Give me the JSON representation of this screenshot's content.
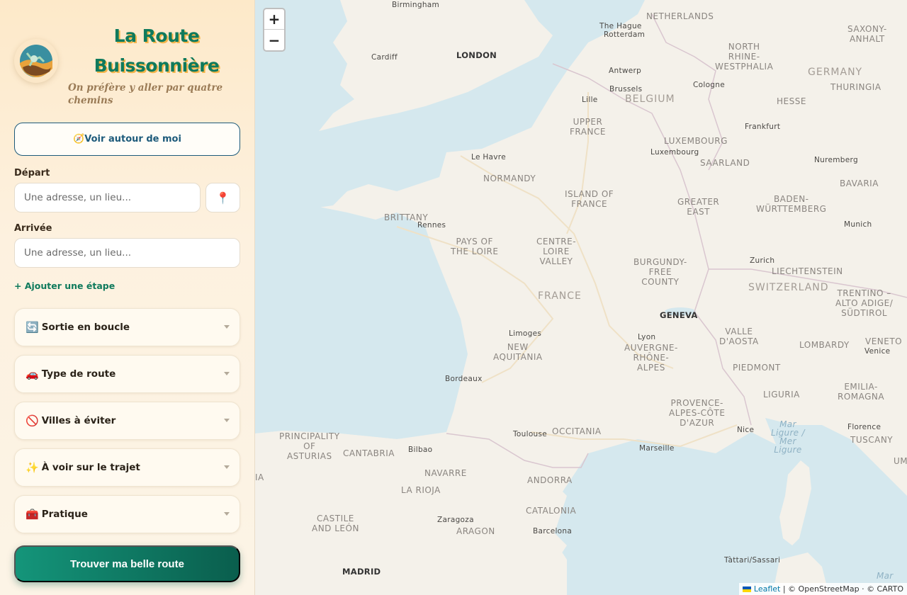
{
  "brand": {
    "title_line1": "La Route",
    "title_line2": "Buissonnière",
    "subtitle": "On préfère y aller par quatre chemins"
  },
  "locate_button": {
    "icon": "compass-icon",
    "label": "🧭Voir autour de moi"
  },
  "departure": {
    "label": "Départ",
    "placeholder": "Une adresse, un lieu...",
    "pin_icon": "📍"
  },
  "arrival": {
    "label": "Arrivée",
    "placeholder": "Une adresse, un lieu..."
  },
  "add_step": "+ Ajouter une étape",
  "sections": [
    {
      "emoji": "🔄",
      "label": "Sortie en boucle"
    },
    {
      "emoji": "🚗",
      "label": "Type de route"
    },
    {
      "emoji": "🚫",
      "label": "Villes à éviter"
    },
    {
      "emoji": "✨",
      "label": "À voir sur le trajet"
    },
    {
      "emoji": "🧰",
      "label": "Pratique"
    }
  ],
  "cta": "Trouver ma belle route",
  "map": {
    "zoom_in": "+",
    "zoom_out": "−",
    "labels": {
      "birmingham": "Birmingham",
      "london": "LONDON",
      "cardiff": "Cardiff",
      "the_hague": "The Hague",
      "rotterdam": "Rotterdam",
      "netherlands": "NETHERLANDS",
      "saxony": "SAXONY-\nANHALT",
      "nrw": "NORTH\nRHINE-\nWESTPHALIA",
      "germany": "GERMANY",
      "antwerp": "Antwerp",
      "brussels": "Brussels",
      "cologne": "Cologne",
      "thuringia": "THURINGIA",
      "lille": "Lille",
      "belgium": "BELGIUM",
      "hesse": "HESSE",
      "upper_france": "UPPER\nFRANCE",
      "frankfurt": "Frankfurt",
      "luxembourg_r": "LUXEMBOURG",
      "luxembourg": "Luxembourg",
      "le_havre": "Le Havre",
      "saarland": "SAARLAND",
      "nuremberg": "Nuremberg",
      "normandy": "NORMANDY",
      "island_of_france": "ISLAND OF\nFRANCE",
      "greater_east": "GREATER\nEAST",
      "baden": "BADEN-\nWÜRTTEMBERG",
      "bavaria": "BAVARIA",
      "brittany": "BRITTANY",
      "rennes": "Rennes",
      "munich": "Munich",
      "pays_loire": "PAYS OF\nTHE LOIRE",
      "centre": "CENTRE-\nLOIRE\nVALLEY",
      "burgundy": "BURGUNDY-\nFREE\nCOUNTY",
      "zurich": "Zurich",
      "liechtenstein": "LIECHTENSTEIN",
      "switzerland": "SWITZERLAND",
      "trentino": "TRENTINO –\nALTO ADIGE/\nSÜDTIROL",
      "france": "FRANCE",
      "geneva": "GENEVA",
      "limoges": "Limoges",
      "lyon": "Lyon",
      "aosta": "VALLE\nD'AOSTA",
      "lombardy": "LOMBARDY",
      "veneto": "VENETO",
      "venice": "Venice",
      "new_aquitania": "NEW\nAQUITANIA",
      "auvergne": "AUVERGNE-\nRHÔNE-\nALPES",
      "bordeaux": "Bordeaux",
      "piedmont": "PIEDMONT",
      "emilia": "EMILIA-\nROMAGNA",
      "liguria": "LIGURIA",
      "provence": "PROVENCE-\nALPES-CÔTE\nD'AZUR",
      "toulouse": "Toulouse",
      "occitania": "OCCITANIA",
      "nice": "Nice",
      "florence": "Florence",
      "asturias": "PRINCIPALITY\nOF\nASTURIAS",
      "cantabria": "CANTABRIA",
      "bilbao": "Bilbao",
      "marseille": "Marseille",
      "ligure": "Mar\nLigure /\nMer\nLigure",
      "tuscany": "TUSCANY",
      "navarre": "NAVARRE",
      "andorra": "ANDORRA",
      "la_rioja": "LA RIOJA",
      "catalonia": "CATALONIA",
      "umbria": "UMB",
      "castile": "CASTILE\nAND LEÓN",
      "zaragoza": "Zaragoza",
      "aragon": "ARAGON",
      "barcelona": "Barcelona",
      "madrid": "MADRID",
      "tattari": "Tàttari/Sassari",
      "ia": "IA",
      "mar": "Mar"
    },
    "attribution": {
      "leaflet": "Leaflet",
      "rest": " | © OpenStreetMap · © CARTO"
    }
  }
}
